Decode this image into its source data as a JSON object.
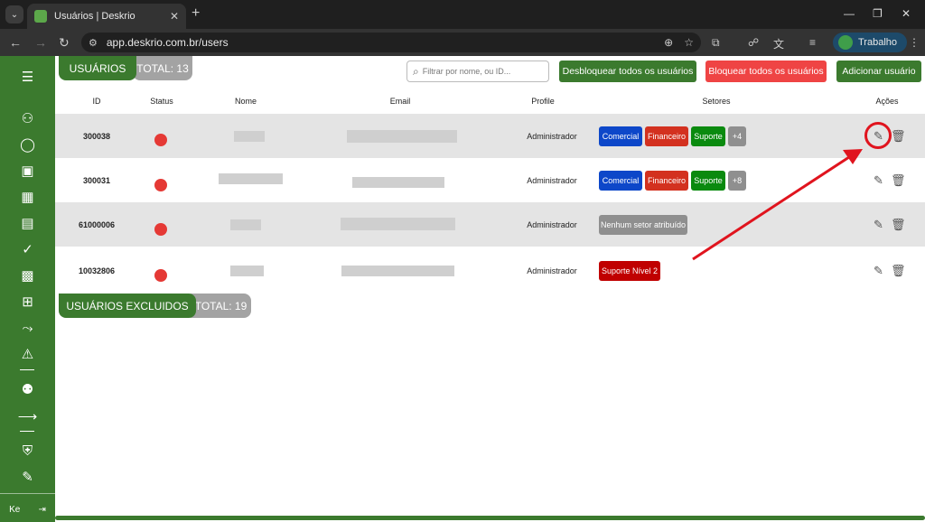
{
  "browser": {
    "tab_title": "Usuários | Deskrio",
    "url": "app.deskrio.com.br/users",
    "profile_label": "Trabalho"
  },
  "header": {
    "users_label": "USUÁRIOS",
    "total_label": "TOTAL: 13",
    "search_placeholder": "Filtrar por nome, ou ID...",
    "unblock_all": "Desbloquear todos os usuários",
    "block_all": "Bloquear todos os usuários",
    "add_user": "Adicionar usuário"
  },
  "table": {
    "columns": [
      "ID",
      "Status",
      "Nome",
      "Email",
      "Profile",
      "Setores",
      "Ações"
    ],
    "rows": [
      {
        "id": "300038",
        "profile": "Administrador",
        "sectors": [
          "Comercial",
          "Financeiro",
          "Suporte",
          "+4"
        ]
      },
      {
        "id": "300031",
        "profile": "Administrador",
        "sectors": [
          "Comercial",
          "Financeiro",
          "Suporte",
          "+8"
        ]
      },
      {
        "id": "61000006",
        "profile": "Administrador",
        "sectors": [
          "Nenhum setor atribuído"
        ]
      },
      {
        "id": "10032806",
        "profile": "Administrador",
        "sectors": [
          "Suporte Nível 2"
        ]
      }
    ]
  },
  "deleted": {
    "label": "USUÁRIOS EXCLUIDOS",
    "total_label": "TOTAL: 19"
  },
  "sidebar": {
    "footer_label": "Ke"
  },
  "colors": {
    "brand_green": "#3b7a2e",
    "danger_red": "#ef4444",
    "status_red": "#e53935",
    "annotation_red": "#e0141e"
  }
}
